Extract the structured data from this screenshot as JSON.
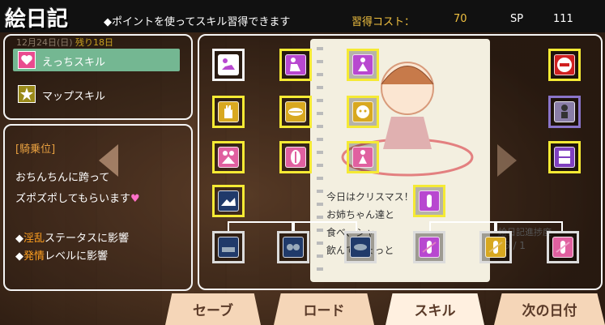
{
  "header": {
    "title": "絵日記",
    "hint": "◆ポイントを使ってスキル習得できます",
    "cost_label": "習得コスト：",
    "cost_value": "70",
    "sp_label": "SP",
    "sp_value": "111"
  },
  "sidebar": {
    "date": "12月24日(日)",
    "remaining": "残り18日",
    "categories": [
      {
        "label": "えっちスキル",
        "icon": "heart-icon",
        "selected": true
      },
      {
        "label": "マップスキル",
        "icon": "star-icon",
        "selected": false
      }
    ]
  },
  "description": {
    "title": "[騎乗位]",
    "line1": "おちんちんに跨って",
    "line2": "ズポズポしてもらいます",
    "heart": "♥",
    "effect1_marker": "◆",
    "effect1_keyword": "淫乱",
    "effect1_rest": "ステータスに影響",
    "effect2_marker": "◆",
    "effect2_keyword": "発情",
    "effect2_rest": "レベルに影響"
  },
  "diary": {
    "line1": "今日はクリスマス！",
    "line2": "お姉ちゃん達と",
    "line3": "食べ、シャ",
    "line4": "飲んでちょっと",
    "side1": "絵日記進捗度",
    "side2": "5 / 1"
  },
  "skills": {
    "nodes": [
      {
        "id": "cunnilingus",
        "icon": "cunnilingus-icon",
        "color": "#ffffff",
        "state": "selected"
      },
      {
        "id": "sitting",
        "icon": "sitting-position-icon",
        "color": "#b848d0",
        "state": "learned"
      },
      {
        "id": "hug",
        "icon": "hug-icon",
        "color": "#b848d0",
        "state": "learned"
      },
      {
        "id": "prohibited",
        "icon": "no-entry-icon",
        "color": "#d02020",
        "state": "learned"
      },
      {
        "id": "hand",
        "icon": "hand-icon",
        "color": "#d8a820",
        "state": "learned"
      },
      {
        "id": "lips",
        "icon": "lips-icon",
        "color": "#d8a820",
        "state": "learned"
      },
      {
        "id": "face",
        "icon": "face-icon",
        "color": "#d8a820",
        "state": "learned"
      },
      {
        "id": "doll",
        "icon": "doll-icon",
        "color": "#8070c0",
        "state": "available"
      },
      {
        "id": "embrace",
        "icon": "embrace-icon",
        "color": "#e060a0",
        "state": "learned"
      },
      {
        "id": "vagina",
        "icon": "vagina-icon",
        "color": "#e060a0",
        "state": "learned"
      },
      {
        "id": "cowgirl",
        "icon": "cowgirl-icon",
        "color": "#e060a0",
        "state": "learned"
      },
      {
        "id": "drawer",
        "icon": "drawer-icon",
        "color": "#8040c0",
        "state": "learned"
      },
      {
        "id": "scene",
        "icon": "scene-icon",
        "color": "#203a6a",
        "state": "learned"
      },
      {
        "id": "toy",
        "icon": "toy-icon",
        "color": "#b848d0",
        "state": "learned"
      },
      {
        "id": "locked-1",
        "icon": "bed-icon",
        "color": "#203a6a",
        "state": "locked"
      },
      {
        "id": "locked-2",
        "icon": "breasts-icon",
        "color": "#203a6a",
        "state": "locked"
      },
      {
        "id": "locked-3",
        "icon": "mouth-icon",
        "color": "#203a6a",
        "state": "locked"
      },
      {
        "id": "locked-4",
        "icon": "toy-cross-icon",
        "color": "#b848d0",
        "state": "locked"
      },
      {
        "id": "locked-5",
        "icon": "toy-cross-icon",
        "color": "#d8a820",
        "state": "locked"
      },
      {
        "id": "locked-6",
        "icon": "toy-cross-icon",
        "color": "#e060a0",
        "state": "locked"
      }
    ]
  },
  "tabs": [
    {
      "label": "セーブ",
      "active": false
    },
    {
      "label": "ロード",
      "active": false
    },
    {
      "label": "スキル",
      "active": true
    },
    {
      "label": "次の日付",
      "active": false
    }
  ]
}
